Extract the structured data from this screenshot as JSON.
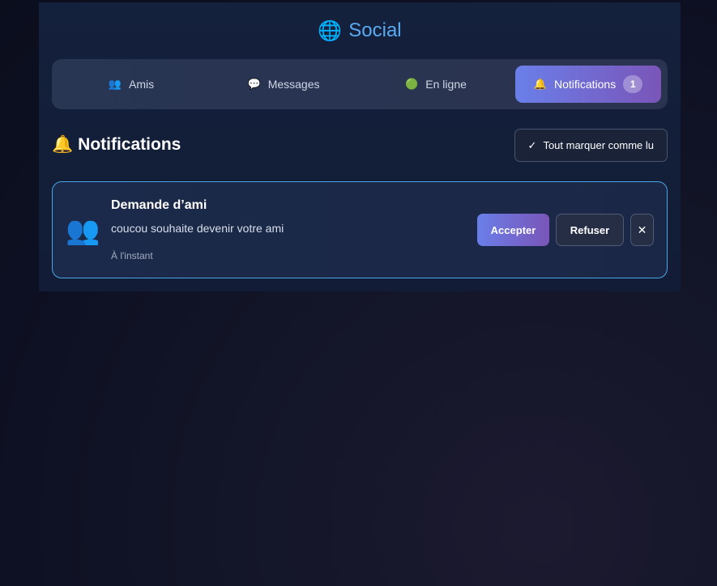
{
  "header": {
    "icon": "globe-icon",
    "title": "Social"
  },
  "tabs": [
    {
      "icon": "friends-icon",
      "label": "Amis",
      "glyph": "👥"
    },
    {
      "icon": "speech-bubble-icon",
      "label": "Messages",
      "glyph": "💬"
    },
    {
      "icon": "green-dot-icon",
      "label": "En ligne",
      "glyph": "🟢"
    },
    {
      "icon": "bell-icon",
      "label": "Notifications",
      "glyph": "🔔",
      "badge": "1",
      "active": true
    }
  ],
  "section": {
    "icon": "bell-icon",
    "title": "Notifications",
    "mark_all_label": "Tout marquer comme lu",
    "mark_all_icon": "check-icon"
  },
  "notifications": [
    {
      "icon": "friends-icon",
      "title": "Demande d’ami",
      "body": "coucou souhaite devenir votre ami",
      "time": "À l'instant",
      "accept_label": "Accepter",
      "refuse_label": "Refuser",
      "dismiss_icon": "close-icon",
      "dismiss_label": "✕"
    }
  ],
  "colors": {
    "accent_blue": "#5aaaf2",
    "gradient_start": "#6a7fe9",
    "gradient_end": "#7a55b8",
    "card_border": "#4aa6e8"
  }
}
